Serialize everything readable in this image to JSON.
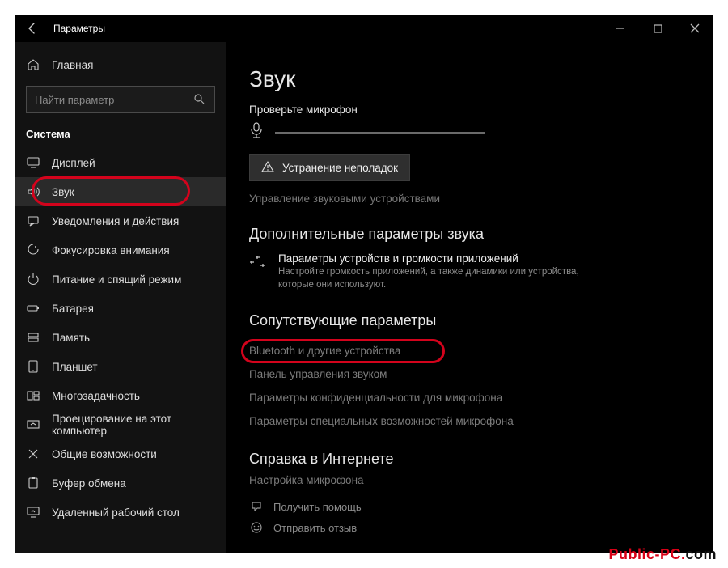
{
  "titlebar": {
    "title": "Параметры"
  },
  "sidebar": {
    "home_label": "Главная",
    "search_placeholder": "Найти параметр",
    "section_label": "Система",
    "items": [
      {
        "label": "Дисплей",
        "icon": "display-icon"
      },
      {
        "label": "Звук",
        "icon": "sound-icon",
        "selected": true
      },
      {
        "label": "Уведомления и действия",
        "icon": "notifications-icon"
      },
      {
        "label": "Фокусировка внимания",
        "icon": "focus-assist-icon"
      },
      {
        "label": "Питание и спящий режим",
        "icon": "power-icon"
      },
      {
        "label": "Батарея",
        "icon": "battery-icon"
      },
      {
        "label": "Память",
        "icon": "storage-icon"
      },
      {
        "label": "Планшет",
        "icon": "tablet-icon"
      },
      {
        "label": "Многозадачность",
        "icon": "multitasking-icon"
      },
      {
        "label": "Проецирование на этот компьютер",
        "icon": "projecting-icon"
      },
      {
        "label": "Общие возможности",
        "icon": "shared-experiences-icon"
      },
      {
        "label": "Буфер обмена",
        "icon": "clipboard-icon"
      },
      {
        "label": "Удаленный рабочий стол",
        "icon": "remote-desktop-icon"
      }
    ]
  },
  "main": {
    "page_title": "Звук",
    "check_mic_label": "Проверьте микрофон",
    "troubleshoot_label": "Устранение неполадок",
    "manage_devices_link": "Управление звуковыми устройствами",
    "advanced_heading": "Дополнительные параметры звука",
    "mixer_title": "Параметры устройств и громкости приложений",
    "mixer_desc": "Настройте громкость приложений, а также динамики или устройства, которые они используют.",
    "related_heading": "Сопутствующие параметры",
    "related_links": [
      "Bluetooth и другие устройства",
      "Панель управления звуком",
      "Параметры конфиденциальности для микрофона",
      "Параметры специальных возможностей микрофона"
    ],
    "help_heading": "Справка в Интернете",
    "help_link": "Настройка микрофона",
    "get_help": "Получить помощь",
    "feedback": "Отправить отзыв"
  },
  "watermark": {
    "a": "Public-PC.",
    "b": "com"
  }
}
